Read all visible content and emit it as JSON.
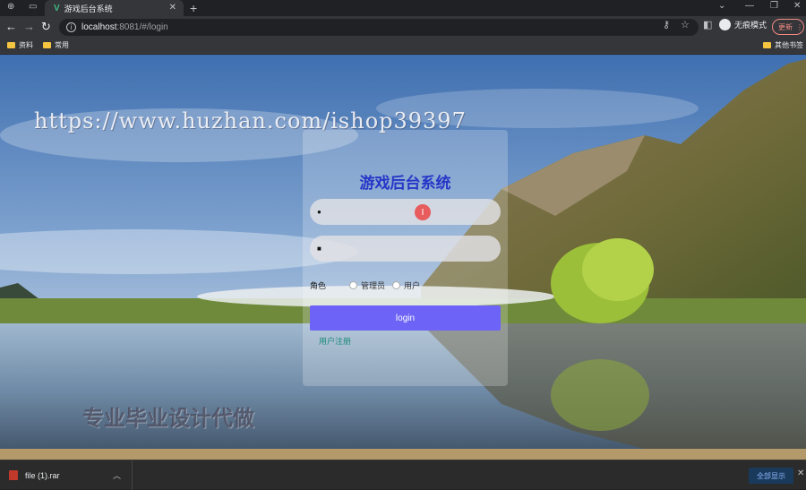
{
  "browser": {
    "tab_title": "游戏后台系统",
    "tab_close": "✕",
    "new_tab": "+",
    "url_host": "localhost",
    "url_path": ":8081/#/login",
    "incognito_label": "无痕模式",
    "update_label": "更新",
    "bookmarks": [
      "资料",
      "常用"
    ],
    "other_bookmarks": "其他书签"
  },
  "page": {
    "watermark_url": "https://www.huzhan.com/ishop39397",
    "watermark_ad": "专业毕业设计代做",
    "login": {
      "title": "游戏后台系统",
      "username_value": "",
      "password_value": "",
      "role_label": "角色",
      "roles": [
        "管理员",
        "用户"
      ],
      "login_button": "login",
      "register_link": "用户注册"
    }
  },
  "downloads": {
    "file_name": "file (1).rar",
    "show_all": "全部显示"
  },
  "colors": {
    "title": "#2536c8",
    "login_button": "#6d63f6",
    "register_link": "#1a8a7a"
  }
}
